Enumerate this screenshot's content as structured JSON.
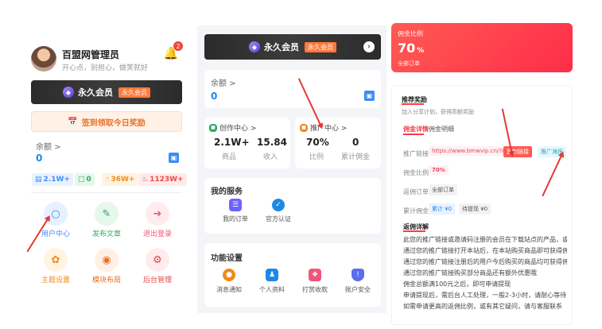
{
  "panel1": {
    "username": "百盟网管理员",
    "motto": "开心点，别担心，做笑就好",
    "bell_badge": "2",
    "vip_label": "永久会员",
    "vip_tag": "永久会员",
    "signin_label": "签到领取今日奖励",
    "balance_label": "余额 >",
    "balance_value": "0",
    "stats": [
      "2.1W+",
      "0",
      "36W+",
      "1123W+"
    ],
    "grid": [
      {
        "label": "用户中心"
      },
      {
        "label": "发布文章"
      },
      {
        "label": "退出登录"
      },
      {
        "label": "主题设置"
      },
      {
        "label": "模块布局"
      },
      {
        "label": "后台管理"
      }
    ]
  },
  "panel2": {
    "vip_label": "永久会员",
    "vip_tag": "永久会员",
    "balance_label": "余额 >",
    "balance_value": "0",
    "creator": {
      "title": "创作中心 >",
      "v1": "2.1W+",
      "l1": "商品",
      "v2": "15.84",
      "l2": "收入"
    },
    "promo": {
      "title": "推广中心 >",
      "v1": "70%",
      "l1": "比例",
      "v2": "0",
      "l2": "累计佣金"
    },
    "services": {
      "title": "我的服务",
      "items": [
        "我的订单",
        "官方认证"
      ]
    },
    "settings": {
      "title": "功能设置",
      "items": [
        "消息通知",
        "个人资料",
        "打赏收款",
        "账户安全"
      ]
    }
  },
  "panel3": {
    "rate_label": "佣金比例",
    "rate_value": "70",
    "rate_unit": "%",
    "rate_sub": "全部订单",
    "reward_title": "推荐奖励",
    "reward_sub": "加入分享计划，获得高额奖励",
    "tabs": [
      "佣金详情",
      "佣金明细"
    ],
    "link_label": "推广链接",
    "link_value": "https://www.bmwvip.cn/?ref=1",
    "copy_button": "复制链接",
    "poster_button": "推广海报",
    "ratio_label": "佣金比例",
    "ratio_value": "70%",
    "orders_label": "返佣订单",
    "orders_value": "全部订单",
    "commission_label": "累计佣金",
    "commission_paid": "累计 ¥0",
    "commission_pending": "待提现 ¥0",
    "rules_title": "返佣详解",
    "rules": [
      "此您的推广链接或邀请码注册的会员在下载站点的产品，或购买会员时即可获得相应比例的佣金",
      "通过您的推广链接打开本站后，在本站购买商品即可获得佣金",
      "通过您的推广链接注册后的用户今后购买的商品均可获得佣金",
      "通过您的推广链接购买部分商品还有额外优惠哦",
      "佣金总额满100元之后，即可申请提现",
      "申请提现后，需后台人工处理，一般2-3小时，请耐心等待",
      "如需申请更高的返佣比例，或有其它疑问，请与客服联系"
    ]
  },
  "colors": {
    "accent_blue": "#1e88e5",
    "vip_orange": "#ff7a3d",
    "rate_red": "#ff3b47",
    "arrow_red": "#e53935"
  }
}
